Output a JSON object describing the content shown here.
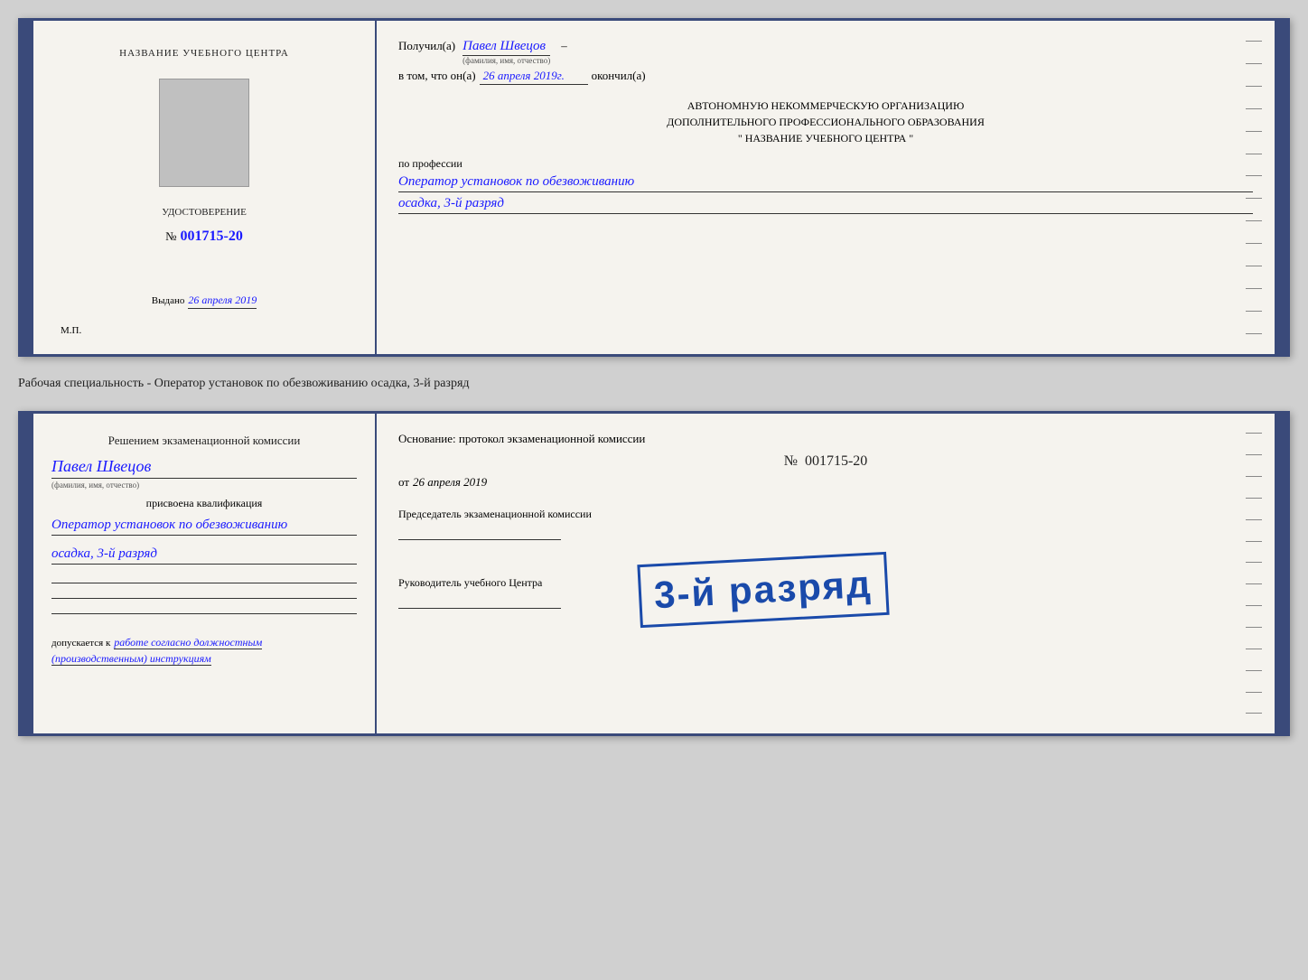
{
  "cert": {
    "left": {
      "title": "НАЗВАНИЕ УЧЕБНОГО ЦЕНТРА",
      "cert_label": "УДОСТОВЕРЕНИЕ",
      "cert_number_prefix": "№",
      "cert_number": "001715-20",
      "issued_label": "Выдано",
      "issued_date": "26 апреля 2019",
      "mp_label": "М.П."
    },
    "right": {
      "received_label": "Получил(а)",
      "received_name": "Павел Швецов",
      "received_name_sub": "(фамилия, имя, отчество)",
      "date_intro": "в том, что он(а)",
      "date_value": "26 апреля 2019г.",
      "date_suffix": "окончил(а)",
      "org_line1": "АВТОНОМНУЮ НЕКОММЕРЧЕСКУЮ ОРГАНИЗАЦИЮ",
      "org_line2": "ДОПОЛНИТЕЛЬНОГО ПРОФЕССИОНАЛЬНОГО ОБРАЗОВАНИЯ",
      "org_line3": "\"   НАЗВАНИЕ УЧЕБНОГО ЦЕНТРА   \"",
      "profession_label": "по профессии",
      "profession_value": "Оператор установок по обезвоживанию",
      "rank_value": "осадка, 3-й разряд"
    }
  },
  "separator": {
    "text": "Рабочая специальность - Оператор установок по обезвоживанию осадка, 3-й разряд"
  },
  "qual": {
    "left": {
      "title": "Решением экзаменационной комиссии",
      "name_value": "Павел Швецов",
      "name_sub": "(фамилия, имя, отчество)",
      "assigned_label": "присвоена квалификация",
      "profession_value": "Оператор установок по обезвоживанию",
      "rank_value": "осадка, 3-й разряд",
      "allowed_label": "допускается к",
      "allowed_value": "работе согласно должностным (производственным) инструкциям"
    },
    "stamp": {
      "text": "3-й разряд"
    },
    "right": {
      "basis_label": "Основание: протокол экзаменационной комиссии",
      "number_prefix": "№",
      "number_value": "001715-20",
      "date_prefix": "от",
      "date_value": "26 апреля 2019",
      "role1": "Председатель экзаменационной комиссии",
      "role2": "Руководитель учебного Центра"
    }
  },
  "side_lines_count": 14
}
